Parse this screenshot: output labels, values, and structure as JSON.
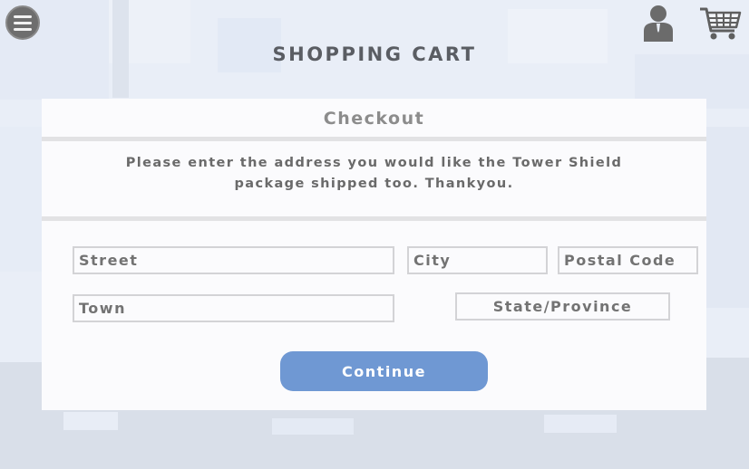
{
  "header": {
    "title": "SHOPPING CART",
    "menu_icon": "hamburger-menu-icon",
    "user_icon": "user-account-icon",
    "cart_icon": "shopping-cart-icon"
  },
  "checkout": {
    "title": "Checkout",
    "message": "Please enter the address you would like the Tower Shield package shipped too. Thankyou.",
    "fields": {
      "street": {
        "placeholder": "Street",
        "value": ""
      },
      "city": {
        "placeholder": "City",
        "value": ""
      },
      "postal_code": {
        "placeholder": "Postal Code",
        "value": ""
      },
      "town": {
        "placeholder": "Town",
        "value": ""
      },
      "state_province": {
        "placeholder": "State/Province",
        "value": ""
      }
    },
    "continue_label": "Continue"
  },
  "colors": {
    "accent": "#6f98d3",
    "title_text": "#5a5d63",
    "background": "#e9eef7",
    "panel": "#fbfbfd"
  }
}
